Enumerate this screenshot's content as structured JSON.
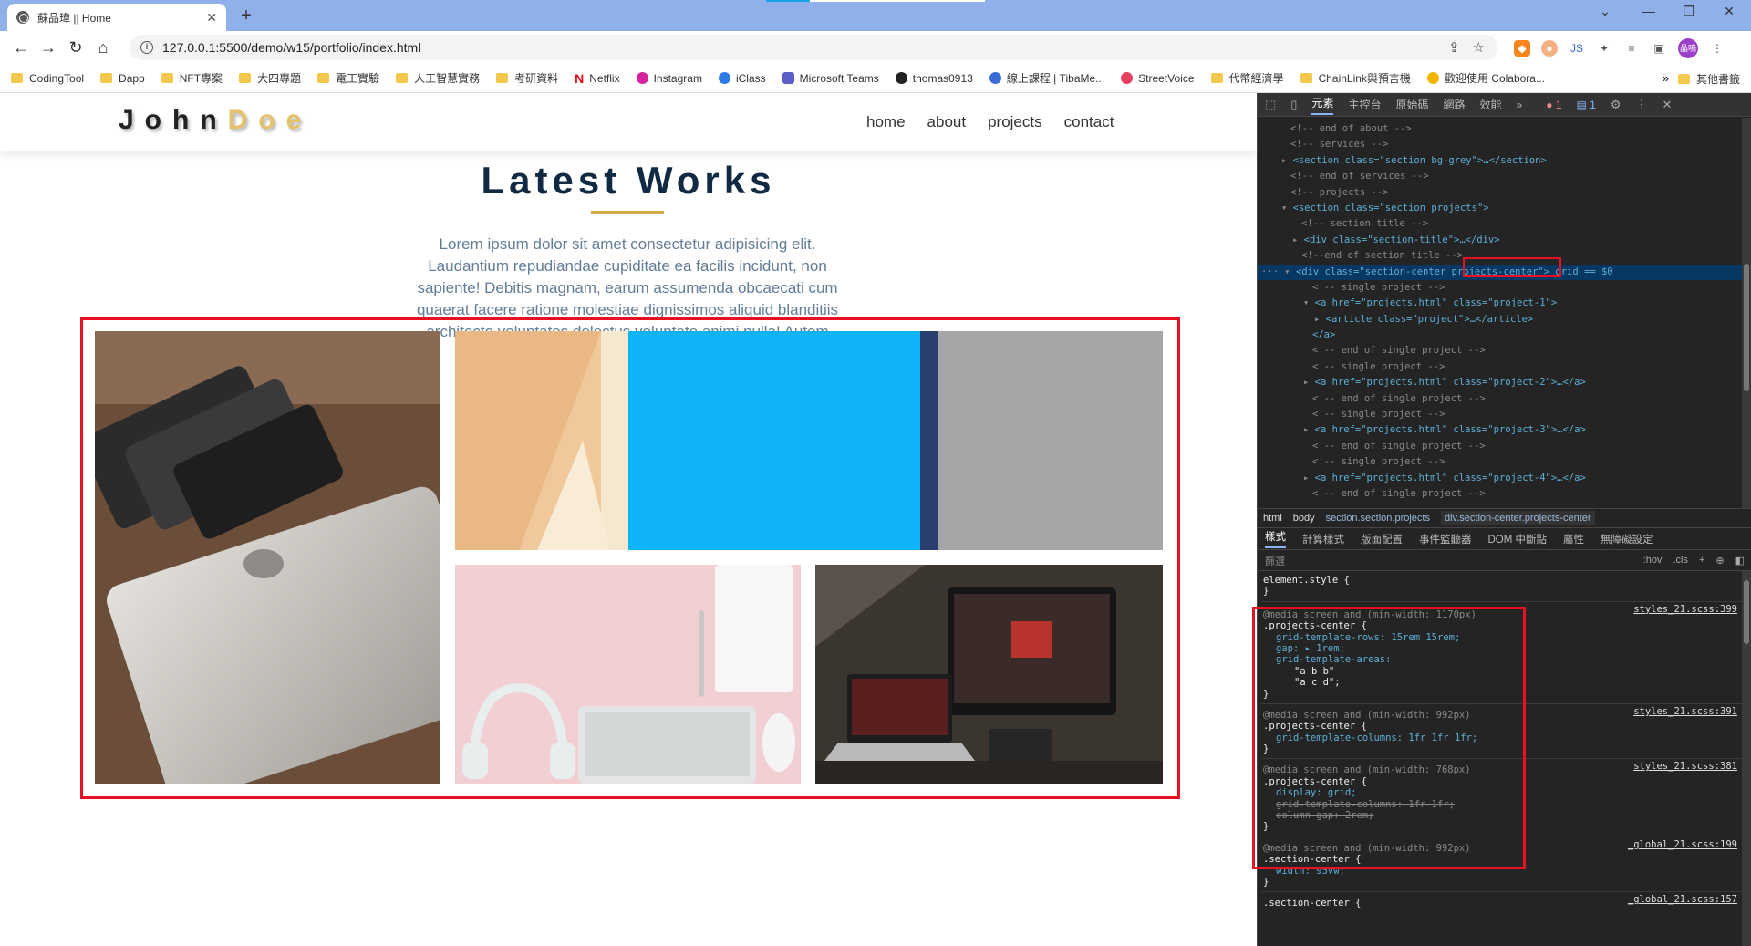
{
  "browser": {
    "tab_title": "蘇品瑋 || Home",
    "new_tab": "+",
    "url": "127.0.0.1:5500/demo/w15/portfolio/index.html",
    "avatar_initials": "晶嗚"
  },
  "bookmarks": [
    "CodingTool",
    "Dapp",
    "NFT專案",
    "大四專題",
    "電工實驗",
    "人工智慧實務",
    "考研資料",
    "Netflix",
    "Instagram",
    "iClass",
    "Microsoft Teams",
    "thomas0913",
    "線上課程 | TibaMe...",
    "StreetVoice",
    "代幣經濟學",
    "ChainLink與預言機",
    "歡迎使用 Colabora..."
  ],
  "bookmarks_more": "»",
  "bookmarks_other": "其他書籤",
  "site": {
    "logo_first": "John",
    "logo_last": "Doe",
    "nav": [
      "home",
      "about",
      "projects",
      "contact"
    ],
    "section_title": "Latest Works",
    "description": "Lorem ipsum dolor sit amet consectetur adipisicing elit. Laudantium repudiandae cupiditate ea facilis incidunt, non sapiente! Debitis magnam, earum assumenda obcaecati cum quaerat facere ratione molestiae dignissimos aliquid blanditiis architecto voluptates delectus voluptate animi nulla! Autem explicabo perspiciatis officia ea.",
    "projects": [
      {
        "name": "project-1",
        "subject": "laptop-and-phones"
      },
      {
        "name": "project-2",
        "subject": "tablet-on-desk"
      },
      {
        "name": "project-3",
        "subject": "desk-with-keyboard-headphones"
      },
      {
        "name": "project-4",
        "subject": "computer-monitor-laptop"
      }
    ]
  },
  "devtools": {
    "tabs": [
      "元素",
      "主控台",
      "原始碼",
      "網路",
      "效能",
      "»"
    ],
    "error_count": "1",
    "message_count": "1",
    "dom_lines": [
      "<!-- end of about -->",
      "<!-- services -->",
      "<section class=\"section bg-grey\">…</section>",
      "<!-- end of services -->",
      "<!-- projects -->",
      "<section class=\"section projects\">",
      "<!-- section title -->",
      "<div class=\"section-title\">…</div>",
      "<!--end of section title -->",
      "<div class=\"section-center projects-center\"> grid == $0",
      "<!-- single project -->",
      "<a href=\"projects.html\" class=\"project-1\">",
      "<article class=\"project\">…</article>",
      "</a>",
      "<!-- end of single project -->",
      "<!-- single project -->",
      "<a href=\"projects.html\" class=\"project-2\">…</a>",
      "<!-- end of single project -->",
      "<!-- single project -->",
      "<a href=\"projects.html\" class=\"project-3\">…</a>",
      "<!-- end of single project -->",
      "<!-- single project -->",
      "<a href=\"projects.html\" class=\"project-4\">…</a>",
      "<!-- end of single project -->"
    ],
    "breadcrumbs": [
      "html",
      "body",
      "section.section.projects",
      "div.section-center.projects-center"
    ],
    "style_tabs": [
      "樣式",
      "計算樣式",
      "版面配置",
      "事件監聽器",
      "DOM 中斷點",
      "屬性",
      "無障礙設定"
    ],
    "filter_placeholder": "篩選",
    "filter_buttons": [
      ":hov",
      ".cls",
      "+"
    ],
    "rules": [
      {
        "media": "",
        "selector": "element.style {",
        "props": [],
        "close": "}",
        "src": ""
      },
      {
        "media": "@media screen and (min-width: 1170px)",
        "selector": ".projects-center {",
        "props": [
          "grid-template-rows: 15rem 15rem;",
          "gap: ▸ 1rem;",
          "grid-template-areas:",
          "\"a b b\"",
          "\"a c d\";"
        ],
        "close": "}",
        "src": "styles_21.scss:399"
      },
      {
        "media": "@media screen and (min-width: 992px)",
        "selector": ".projects-center {",
        "props": [
          "grid-template-columns: 1fr 1fr 1fr;"
        ],
        "close": "}",
        "src": "styles_21.scss:391"
      },
      {
        "media": "@media screen and (min-width: 768px)",
        "selector": ".projects-center {",
        "props": [
          "display: grid;",
          "grid-template-columns: 1fr 1fr;",
          "column-gap: 2rem;"
        ],
        "close": "}",
        "src": "styles_21.scss:381"
      },
      {
        "media": "@media screen and (min-width: 992px)",
        "selector": ".section-center {",
        "props": [
          "width: 95vw;"
        ],
        "close": "}",
        "src": "_global_21.scss:199"
      },
      {
        "media": "",
        "selector": ".section-center {",
        "props": [],
        "close": "",
        "src": "_global_21.scss:157"
      }
    ]
  }
}
